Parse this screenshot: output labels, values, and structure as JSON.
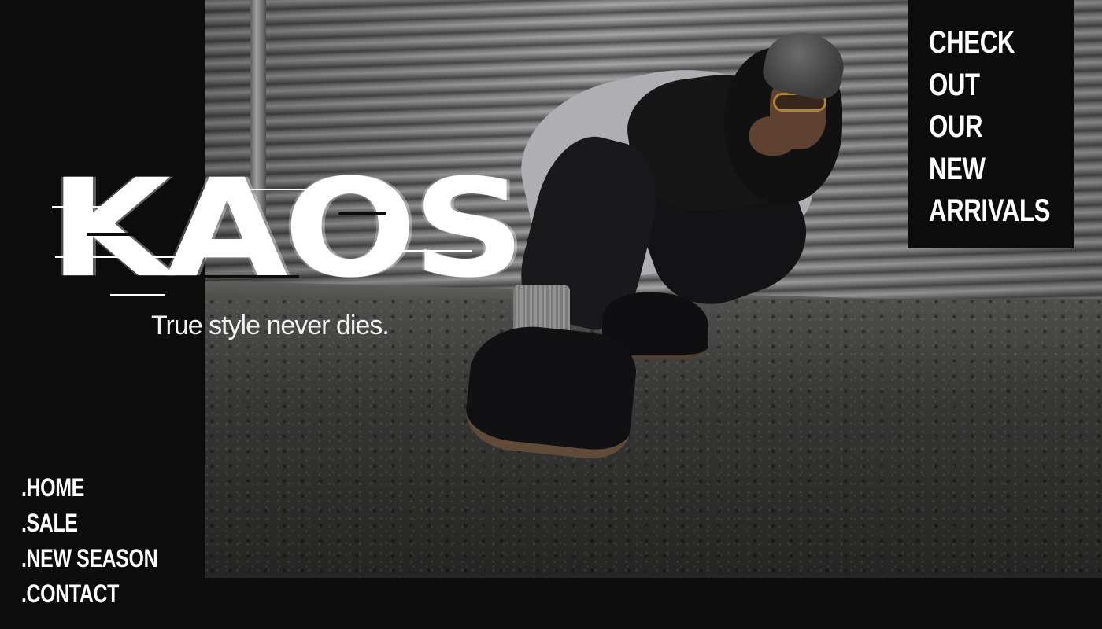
{
  "brand": {
    "logo_text": "KAOS",
    "tagline": "True style never dies."
  },
  "cta": {
    "lines": [
      "CHECK",
      "OUT",
      "OUR",
      "NEW",
      "ARRIVALS"
    ]
  },
  "nav": {
    "items": [
      {
        "label": ".HOME"
      },
      {
        "label": ".SALE"
      },
      {
        "label": ".NEW SEASON"
      },
      {
        "label": ".CONTACT"
      }
    ]
  },
  "hero": {
    "image_subject": "hero-photo"
  },
  "colors": {
    "background": "#0c0c0c",
    "text": "#ffffff"
  }
}
